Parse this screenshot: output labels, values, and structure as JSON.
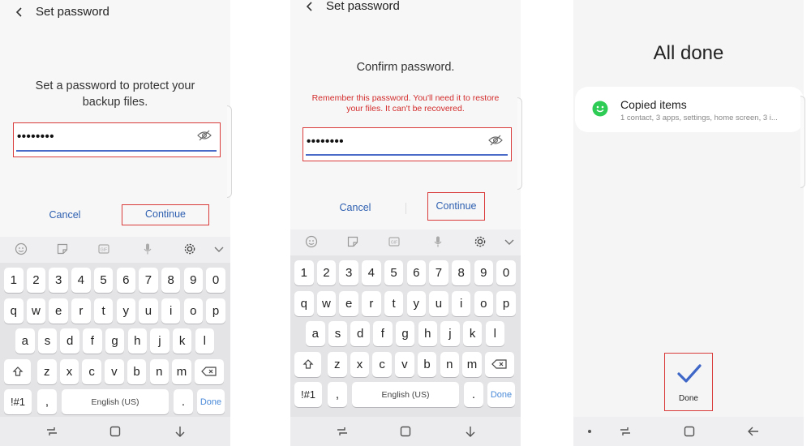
{
  "screen1": {
    "title": "Set password",
    "prompt_line1": "Set a password to protect your",
    "prompt_line2": "backup files.",
    "password_value": "••••••••",
    "cancel_label": "Cancel",
    "continue_label": "Continue"
  },
  "screen2": {
    "title": "Set password",
    "prompt": "Confirm password.",
    "warning_line1": "Remember this password. You'll need it to restore",
    "warning_line2": "your files. It can't be recovered.",
    "password_value": "••••••••",
    "cancel_label": "Cancel",
    "continue_label": "Continue"
  },
  "screen3": {
    "heading": "All done",
    "card_title": "Copied items",
    "card_subtitle": "1 contact, 3 apps, settings, home screen, 3 i...",
    "done_label": "Done"
  },
  "keyboard": {
    "toolbar_icons": [
      "emoji-icon",
      "sticker-icon",
      "gif-icon",
      "mic-icon",
      "settings-gear-icon",
      "chevron-down-icon"
    ],
    "row_numbers": [
      "1",
      "2",
      "3",
      "4",
      "5",
      "6",
      "7",
      "8",
      "9",
      "0"
    ],
    "row_top": [
      "q",
      "w",
      "e",
      "r",
      "t",
      "y",
      "u",
      "i",
      "o",
      "p"
    ],
    "row_middle": [
      "a",
      "s",
      "d",
      "f",
      "g",
      "h",
      "j",
      "k",
      "l"
    ],
    "row_bottom": [
      "z",
      "x",
      "c",
      "v",
      "b",
      "n",
      "m"
    ],
    "symbols_label": "!#1",
    "comma_label": ",",
    "space_label": "English (US)",
    "period_label": ".",
    "done_label": "Done"
  },
  "colors": {
    "highlight_red": "#d93a3a",
    "link_blue": "#2d5fb0",
    "underline_blue": "#4a6bc8",
    "warning_red": "#d32b2b",
    "check_blue": "#3f67c7",
    "smile_green": "#2ecc55"
  }
}
